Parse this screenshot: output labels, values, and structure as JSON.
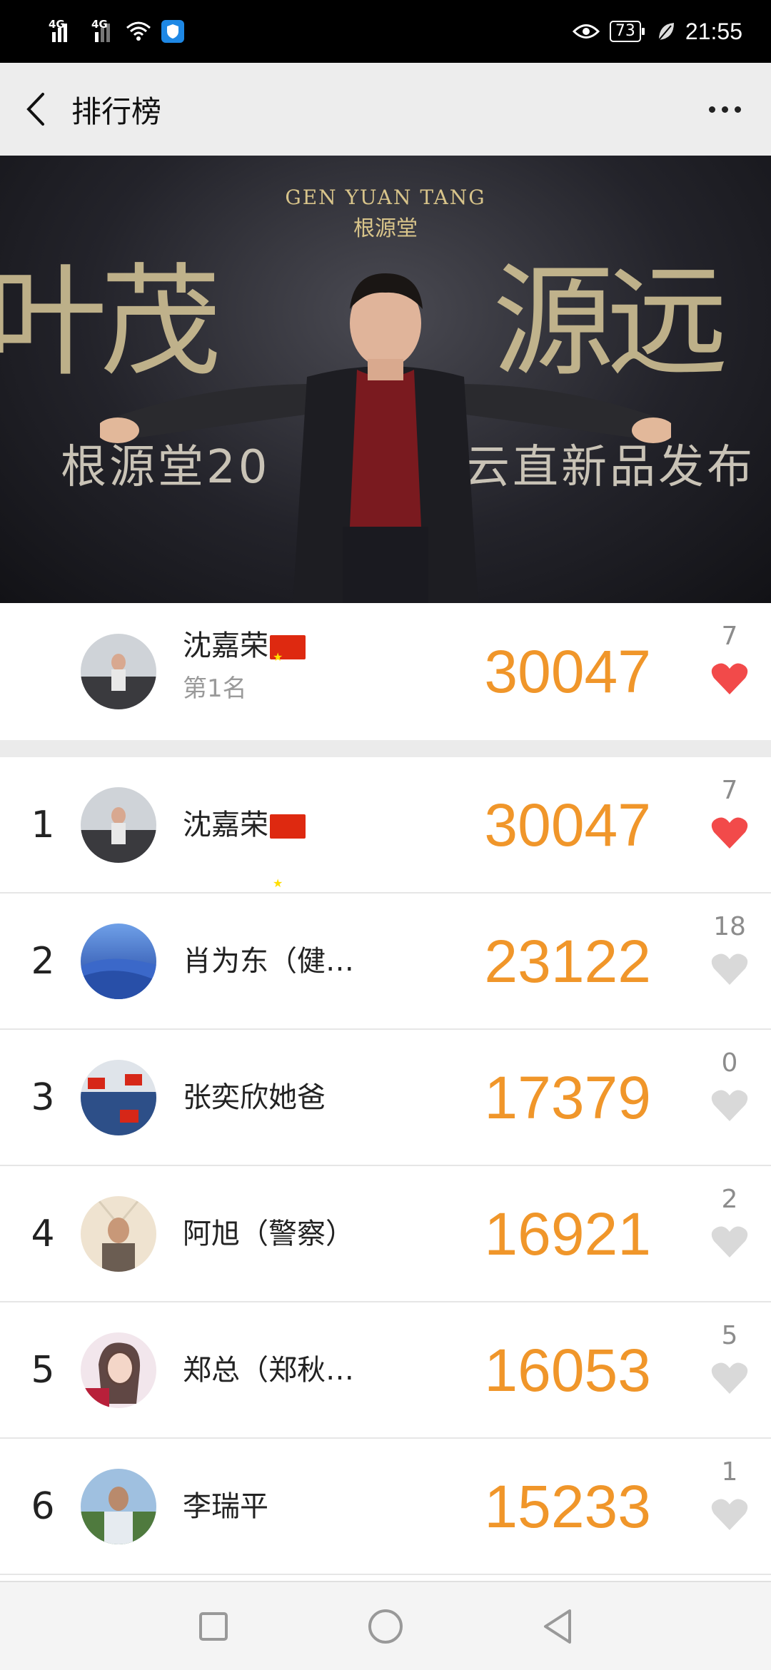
{
  "status_bar": {
    "signal1_label": "4G",
    "signal2_label": "4G",
    "battery": "73",
    "time": "21:55"
  },
  "header": {
    "title": "排行榜",
    "back_icon": "chevron-left-icon",
    "more_icon": "more-dots-icon"
  },
  "banner": {
    "brand_en": "GEN YUAN TANG",
    "brand_cn": "根源堂",
    "big_left": "叶茂",
    "big_right": "源远",
    "sub_left": "根源堂20",
    "sub_right": "云直新品发布"
  },
  "top_user": {
    "name": "沈嘉荣",
    "rank_text": "第1名",
    "score": "30047",
    "likes": "7",
    "liked": true
  },
  "rankings": [
    {
      "rank": "1",
      "name": "沈嘉荣",
      "flag": true,
      "score": "30047",
      "likes": "7",
      "liked": true
    },
    {
      "rank": "2",
      "name": "肖为东（健…",
      "flag": false,
      "score": "23122",
      "likes": "18",
      "liked": false
    },
    {
      "rank": "3",
      "name": "张奕欣她爸",
      "flag": false,
      "score": "17379",
      "likes": "0",
      "liked": false
    },
    {
      "rank": "4",
      "name": "阿旭（警察）",
      "flag": false,
      "score": "16921",
      "likes": "2",
      "liked": false
    },
    {
      "rank": "5",
      "name": "郑总（郑秋…",
      "flag": false,
      "score": "16053",
      "likes": "5",
      "liked": false
    },
    {
      "rank": "6",
      "name": "李瑞平",
      "flag": false,
      "score": "15233",
      "likes": "1",
      "liked": false
    }
  ],
  "colors": {
    "score": "#f0962a",
    "heart_active": "#f24a4a",
    "heart_inactive": "#d9d9d9"
  }
}
